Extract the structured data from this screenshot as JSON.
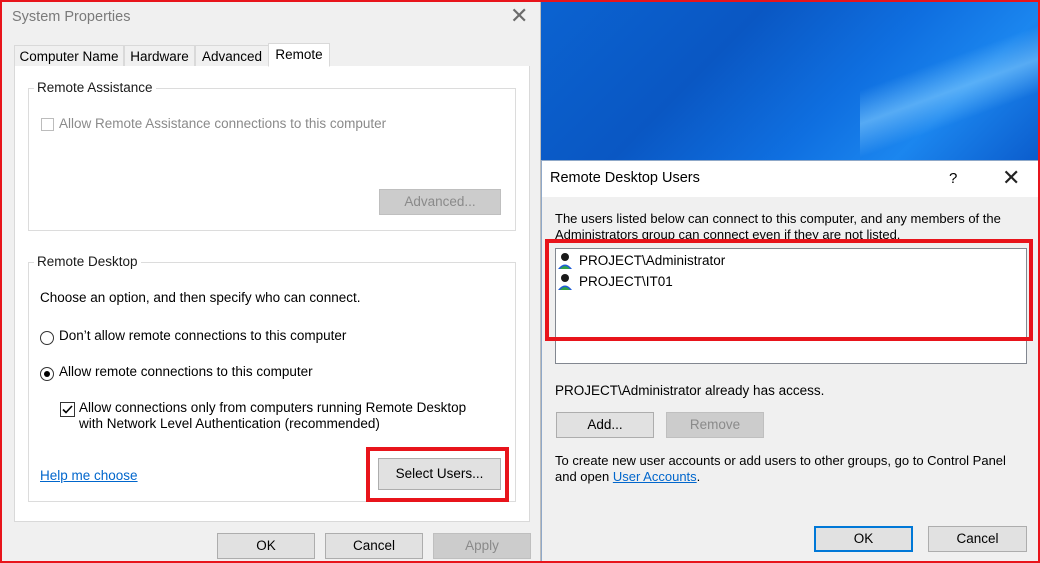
{
  "system_properties": {
    "title": "System Properties",
    "tabs": [
      {
        "label": "Computer Name"
      },
      {
        "label": "Hardware"
      },
      {
        "label": "Advanced"
      },
      {
        "label": "Remote"
      }
    ],
    "selected_tab": "Remote",
    "remote_assistance": {
      "legend": "Remote Assistance",
      "allow_label": "Allow Remote Assistance connections to this computer",
      "allow_checked": false,
      "advanced_button": "Advanced..."
    },
    "remote_desktop": {
      "legend": "Remote Desktop",
      "instruction": "Choose an option, and then specify who can connect.",
      "option_dont_allow": "Don’t allow remote connections to this computer",
      "option_allow": "Allow remote connections to this computer",
      "selected_option": "allow",
      "nla_line1": "Allow connections only from computers running Remote Desktop",
      "nla_line2": "with Network Level Authentication (recommended)",
      "nla_checked": true,
      "help_link": "Help me choose",
      "select_users_button": "Select Users..."
    },
    "buttons": {
      "ok": "OK",
      "cancel": "Cancel",
      "apply": "Apply"
    }
  },
  "remote_desktop_users": {
    "title": "Remote Desktop Users",
    "help_glyph": "?",
    "description_line1": "The users listed below can connect to this computer, and any members of the",
    "description_line2": "Administrators group can connect even if they are not listed.",
    "users": [
      {
        "name": "PROJECT\\Administrator"
      },
      {
        "name": "PROJECT\\IT01"
      }
    ],
    "access_note": "PROJECT\\Administrator already has access.",
    "add_button": "Add...",
    "remove_button": "Remove",
    "footer_line1": "To create new user accounts or add users to other groups, go to Control Panel",
    "footer_prefix": "and open ",
    "footer_link": "User Accounts",
    "footer_suffix": ".",
    "ok_button": "OK",
    "cancel_button": "Cancel"
  },
  "colors": {
    "highlight_red": "#e8141b",
    "link_blue": "#0066cc",
    "desktop_blue": "#0b63d1"
  }
}
